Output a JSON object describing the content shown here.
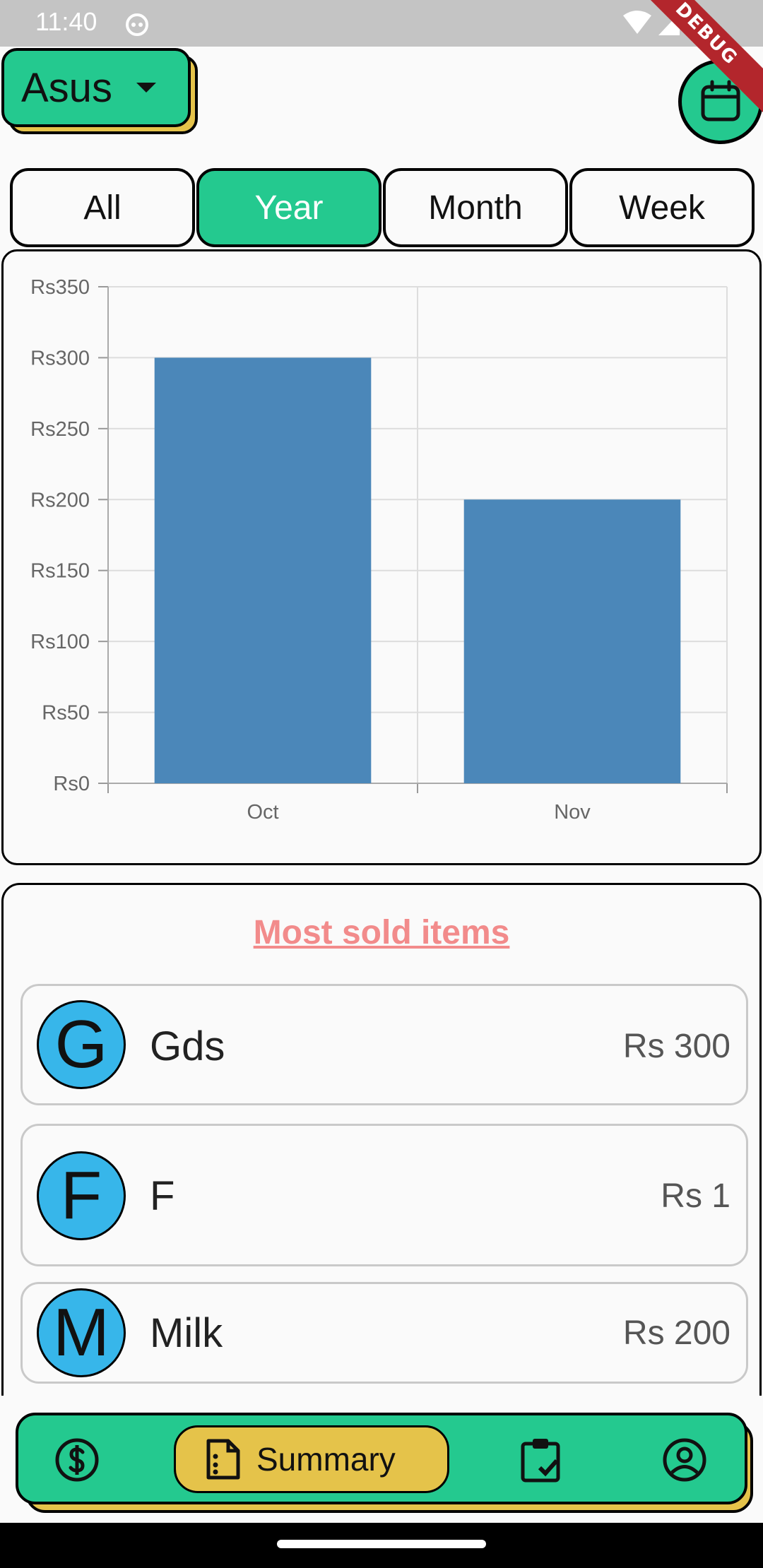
{
  "status_bar": {
    "time": "11:40",
    "debug_label": "DEBUG"
  },
  "header": {
    "store_label": "Asus",
    "calendar_icon": "calendar-icon"
  },
  "period_tabs": [
    {
      "label": "All",
      "active": false
    },
    {
      "label": "Year",
      "active": true
    },
    {
      "label": "Month",
      "active": false
    },
    {
      "label": "Week",
      "active": false
    }
  ],
  "colors": {
    "accent_green": "#24c98f",
    "accent_yellow": "#e5c34a",
    "bar_blue": "#4b87b9",
    "title_pink": "#f28b8b",
    "avatar_blue": "#37b6ea"
  },
  "chart_data": {
    "type": "bar",
    "categories": [
      "Oct",
      "Nov"
    ],
    "values": [
      300,
      200
    ],
    "ylim": [
      0,
      350
    ],
    "yticks": [
      0,
      50,
      100,
      150,
      200,
      250,
      300,
      350
    ],
    "ytick_labels": [
      "Rs0",
      "Rs50",
      "Rs100",
      "Rs150",
      "Rs200",
      "Rs250",
      "Rs300",
      "Rs350"
    ],
    "grid": true
  },
  "most_sold": {
    "title": "Most sold items",
    "items": [
      {
        "initial": "G",
        "name": "Gds",
        "price": "Rs 300"
      },
      {
        "initial": "F",
        "name": "F",
        "price": "Rs 1"
      },
      {
        "initial": "M",
        "name": "Milk",
        "price": "Rs 200"
      }
    ]
  },
  "bottom_nav": {
    "summary_label": "Summary",
    "icons": [
      "dollar-icon",
      "summary-icon",
      "clipboard-check-icon",
      "account-icon"
    ]
  }
}
